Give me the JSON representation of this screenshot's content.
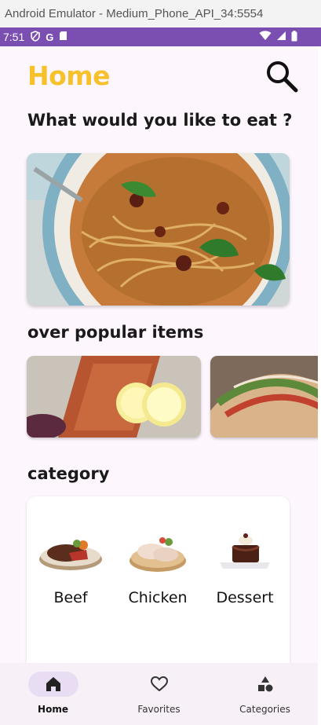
{
  "window": {
    "title": "Android Emulator - Medium_Phone_API_34:5554"
  },
  "status_bar": {
    "time": "7:51",
    "icons": [
      "shield-icon",
      "google-g-icon",
      "sd-card-icon",
      "wifi-icon",
      "cellular-icon",
      "battery-icon"
    ]
  },
  "header": {
    "title": "Home",
    "search_icon": "search-icon"
  },
  "prompt": {
    "question": "What would you like to eat ?"
  },
  "hero": {
    "image": "pasta-dish-photo"
  },
  "popular": {
    "heading": "over popular items",
    "items": [
      {
        "image": "grilled-salmon-lemon-photo"
      },
      {
        "image": "tacos-photo"
      }
    ]
  },
  "category": {
    "heading": "category",
    "items": [
      {
        "label": "Beef",
        "image": "beef-steak-photo"
      },
      {
        "label": "Chicken",
        "image": "chicken-photo"
      },
      {
        "label": "Dessert",
        "image": "chocolate-dessert-photo"
      }
    ]
  },
  "bottom_nav": {
    "items": [
      {
        "label": "Home",
        "icon": "home-icon",
        "active": true
      },
      {
        "label": "Favorites",
        "icon": "heart-icon",
        "active": false
      },
      {
        "label": "Categories",
        "icon": "categories-icon",
        "active": false
      }
    ]
  },
  "colors": {
    "accent": "#f6c12a",
    "status_bar": "#7b4fb1",
    "background": "#fdf6fd",
    "nav_active_pill": "#e8ddf2"
  }
}
